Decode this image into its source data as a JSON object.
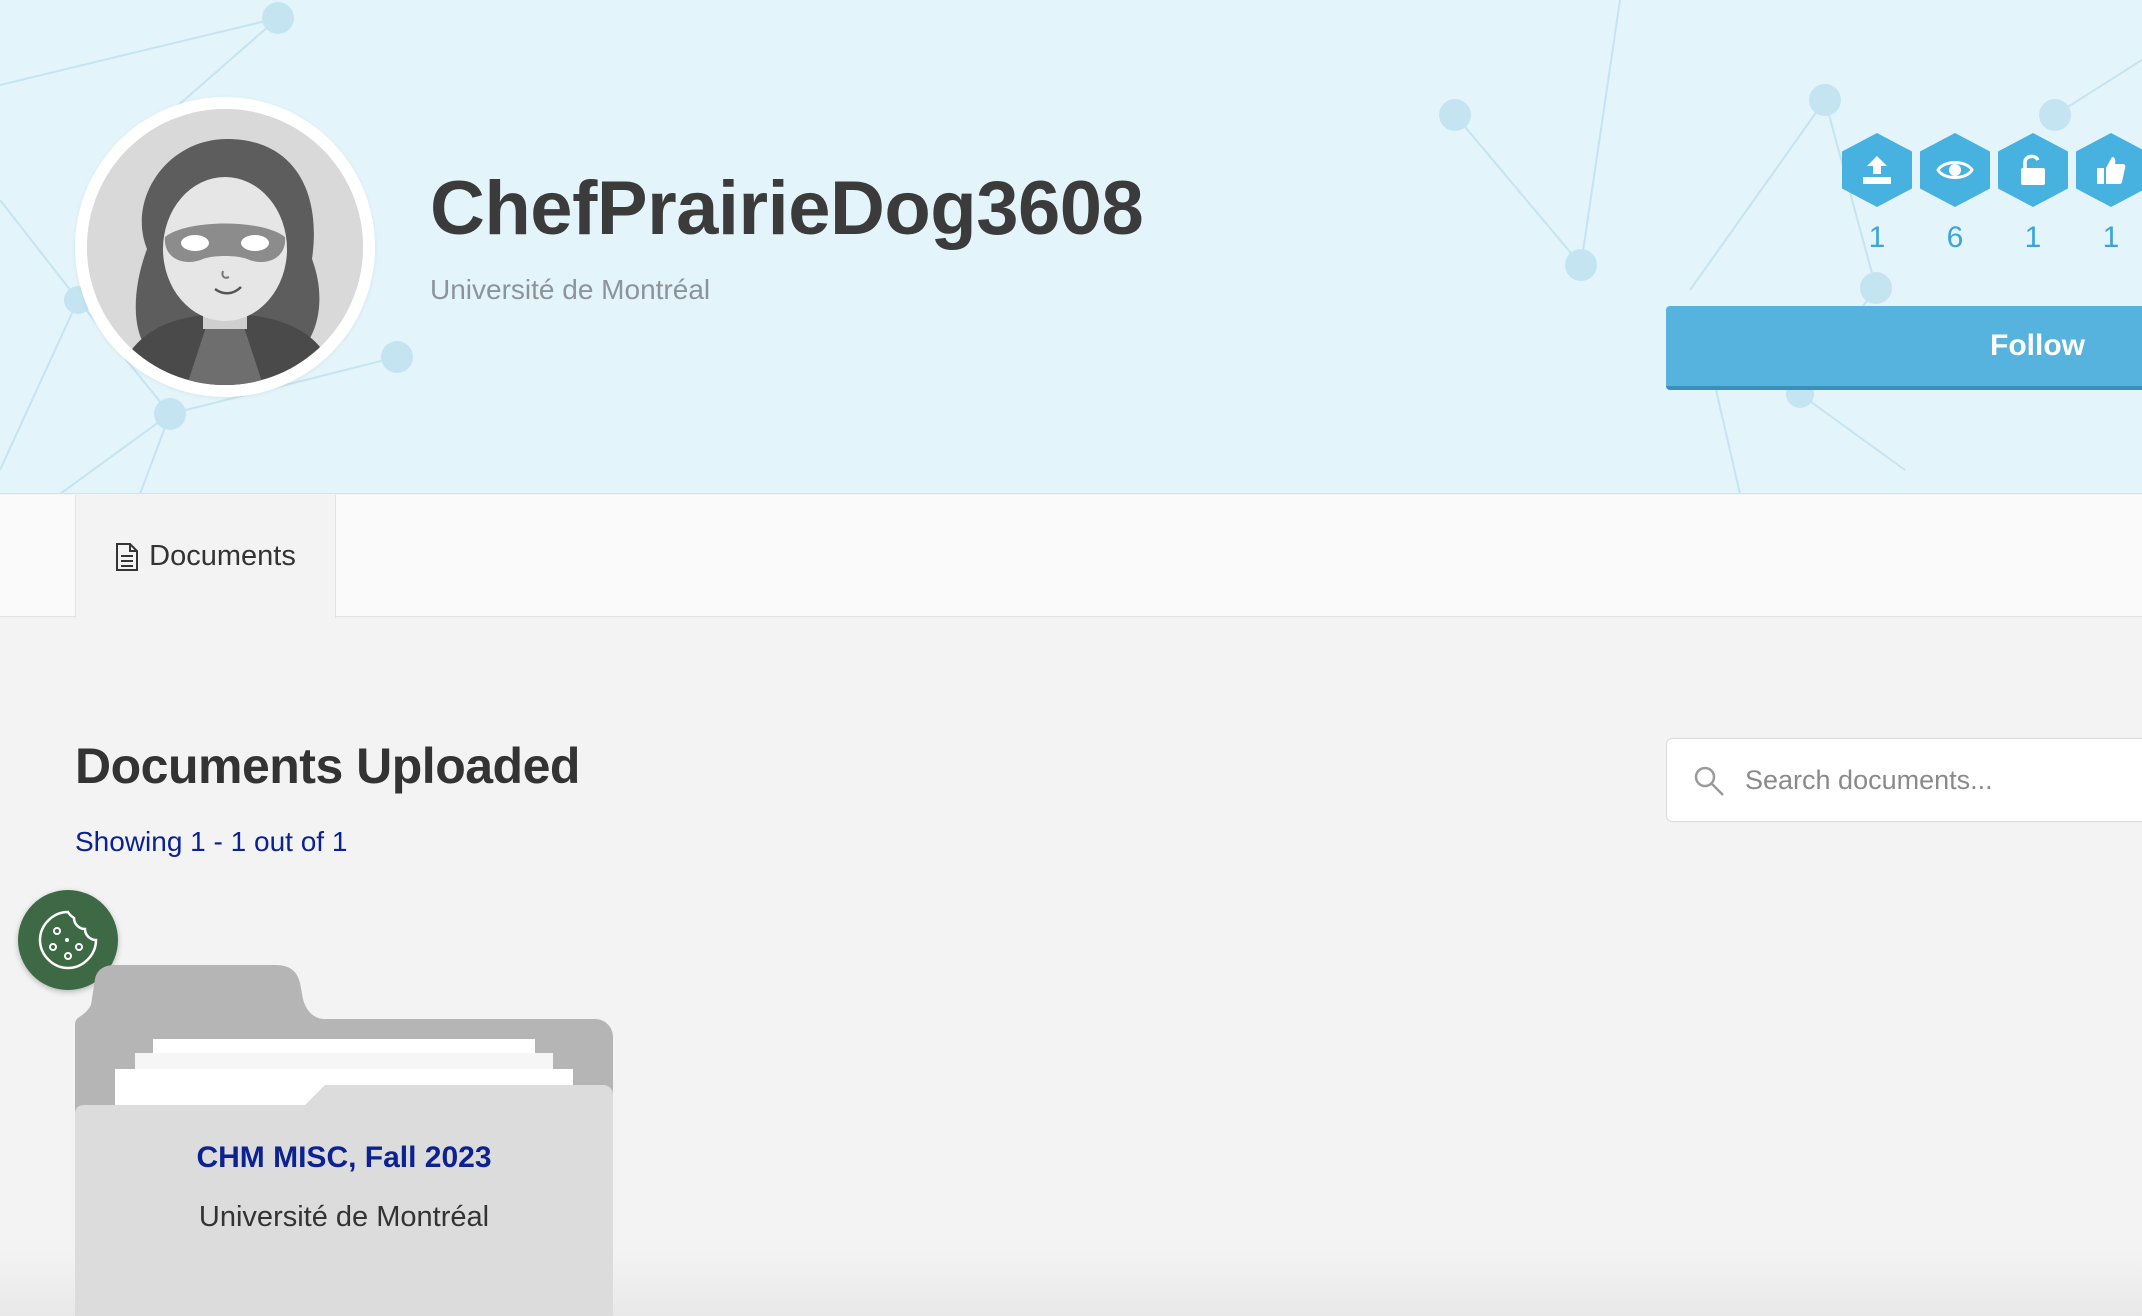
{
  "profile": {
    "username": "ChefPrairieDog3608",
    "school": "Université de Montréal",
    "avatar_icon": "masked-avatar-icon"
  },
  "stats": [
    {
      "icon": "upload-icon",
      "value": "1"
    },
    {
      "icon": "eye-icon",
      "value": "6"
    },
    {
      "icon": "unlock-icon",
      "value": "1"
    },
    {
      "icon": "thumbs-up-icon",
      "value": "1"
    }
  ],
  "follow_label": "Follow",
  "tabs": [
    {
      "label": "Documents",
      "icon": "document-icon"
    }
  ],
  "main": {
    "title": "Documents Uploaded",
    "showing": "Showing 1 - 1 out of 1"
  },
  "search": {
    "placeholder": "Search documents...",
    "value": ""
  },
  "documents": [
    {
      "title": "CHM MISC, Fall 2023",
      "school": "Université de Montréal"
    }
  ],
  "colors": {
    "hero_bg": "#e3f4fb",
    "accent": "#47b1e0",
    "follow": "#55b3dd",
    "link": "#0b2290",
    "cookie": "#3d6a45"
  }
}
